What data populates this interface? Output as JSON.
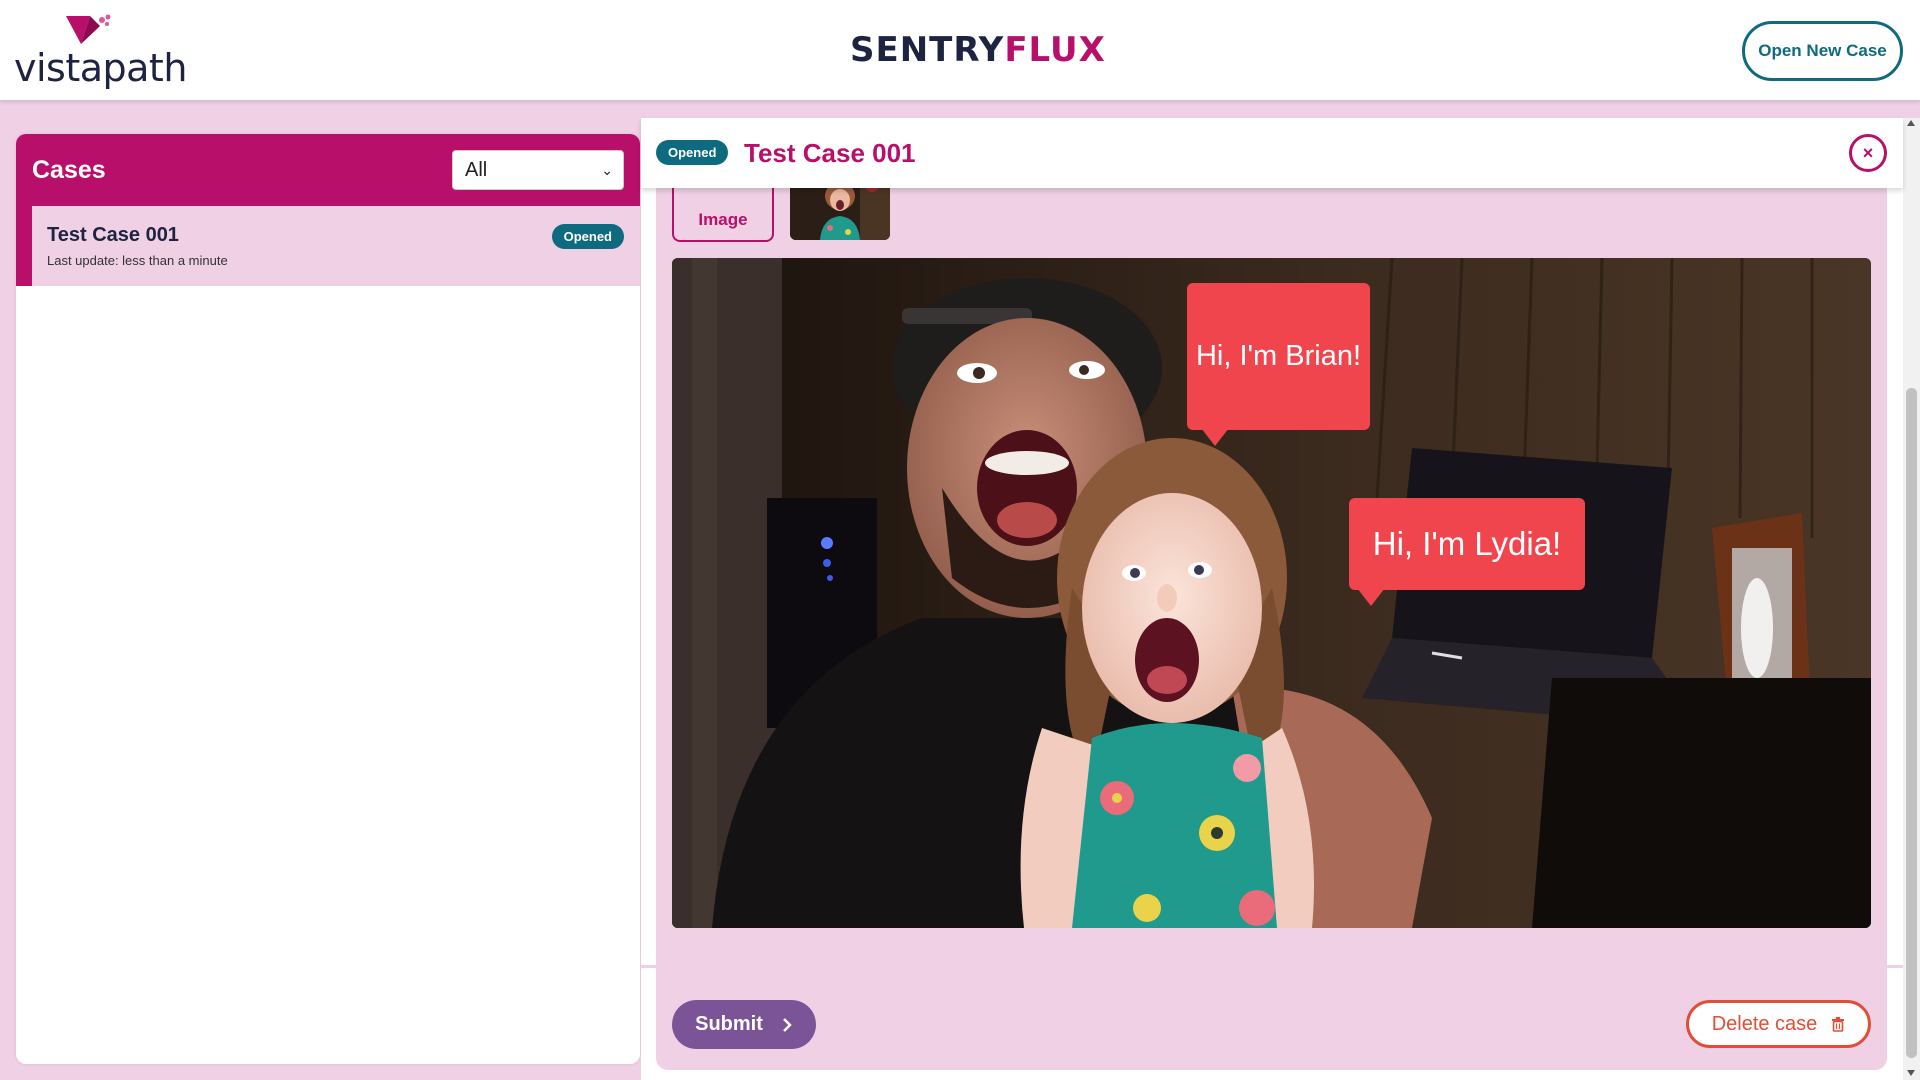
{
  "header": {
    "logo_text": "vistapath",
    "brand_part1": "SENTRY",
    "brand_part2": "FLUX",
    "open_new_case": "Open New Case"
  },
  "sidebar": {
    "title": "Cases",
    "filter_value": "All",
    "cases": [
      {
        "name": "Test Case 001",
        "last_update": "Last update: less than a minute",
        "status": "Opened"
      }
    ]
  },
  "case": {
    "status": "Opened",
    "title": "Test Case 001",
    "add_image_label": "Image",
    "bubbles": {
      "brian": "Hi, I'm Brian!",
      "lydia": "Hi, I'm Lydia!"
    }
  },
  "actions": {
    "submit": "Submit",
    "delete": "Delete case"
  },
  "colors": {
    "brand_magenta": "#b80f6a",
    "teal": "#0e6b7f",
    "navy": "#1d2340",
    "submit_purple": "#7a5496",
    "delete_red": "#e04e36",
    "bubble_red": "#f0454d",
    "panel_pink": "#efd0e4"
  },
  "icons": {
    "close": "close-icon",
    "submit_chevron": "chevron-right-icon",
    "delete": "trash-icon",
    "filter_chevron": "chevron-down-icon"
  }
}
